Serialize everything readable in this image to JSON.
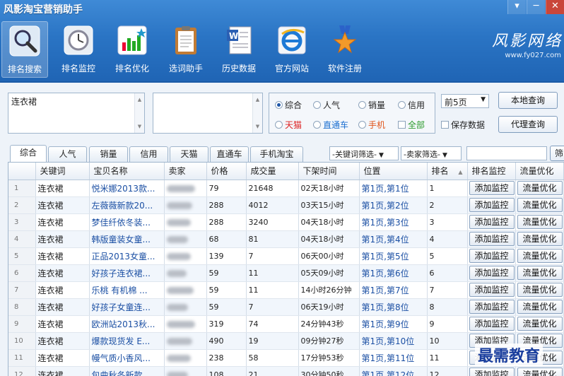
{
  "app": {
    "title": "风影淘宝营销助手",
    "window_buttons": [
      "▾",
      "─",
      "✕"
    ]
  },
  "toolbar": [
    {
      "label": "排名搜索",
      "icon": "magnifier-icon",
      "active": true
    },
    {
      "label": "排名监控",
      "icon": "clock-icon",
      "active": false
    },
    {
      "label": "排名优化",
      "icon": "bar-chart-icon",
      "active": false
    },
    {
      "label": "选词助手",
      "icon": "clipboard-icon",
      "active": false
    },
    {
      "label": "历史数据",
      "icon": "document-icon",
      "active": false
    },
    {
      "label": "官方网站",
      "icon": "browser-e-icon",
      "active": false
    },
    {
      "label": "软件注册",
      "icon": "star-medal-icon",
      "active": false
    }
  ],
  "brand": {
    "name": "风影网络",
    "url": "www.fy027.com"
  },
  "search": {
    "keyword_value": "连衣裙",
    "filters": {
      "sort_options": [
        "综合",
        "人气",
        "销量",
        "信用"
      ],
      "selected_sort": "综合",
      "platform_options": [
        "天猫",
        "直通车",
        "手机"
      ],
      "all_label": "全部"
    },
    "pages_value": "前5页",
    "save_data_label": "保存数据",
    "local_query_label": "本地查询",
    "proxy_query_label": "代理查询"
  },
  "tabs": [
    "综合",
    "人气",
    "销量",
    "信用",
    "天猫",
    "直通车",
    "手机淘宝"
  ],
  "keyword_filter": "-关键词筛选-",
  "seller_filter": "-卖家筛选-",
  "filter_button_label": "筛",
  "table": {
    "columns": [
      "关键词",
      "宝贝名称",
      "卖家",
      "价格",
      "成交量",
      "下架时间",
      "位置",
      "排名",
      "排名监控",
      "流量优化"
    ],
    "sort_indicator": "▲",
    "rows": [
      {
        "n": "1",
        "kw": "连衣裙",
        "name": "悦米娜2013款...",
        "price": "79",
        "sales": "21648",
        "time": "02天18小时",
        "pos": "第1页,第1位",
        "rank": "1"
      },
      {
        "n": "2",
        "kw": "连衣裙",
        "name": "左薇薇新款20...",
        "price": "288",
        "sales": "4012",
        "time": "03天15小时",
        "pos": "第1页,第2位",
        "rank": "2"
      },
      {
        "n": "3",
        "kw": "连衣裙",
        "name": "梦佳纤依冬装...",
        "price": "288",
        "sales": "3240",
        "time": "04天18小时",
        "pos": "第1页,第3位",
        "rank": "3"
      },
      {
        "n": "4",
        "kw": "连衣裙",
        "name": "韩版童装女童...",
        "price": "68",
        "sales": "81",
        "time": "04天18小时",
        "pos": "第1页,第4位",
        "rank": "4"
      },
      {
        "n": "5",
        "kw": "连衣裙",
        "name": "正品2013女童...",
        "price": "139",
        "sales": "7",
        "time": "06天00小时",
        "pos": "第1页,第5位",
        "rank": "5"
      },
      {
        "n": "6",
        "kw": "连衣裙",
        "name": "好孩子连衣裙...",
        "price": "59",
        "sales": "11",
        "time": "05天09小时",
        "pos": "第1页,第6位",
        "rank": "6"
      },
      {
        "n": "7",
        "kw": "连衣裙",
        "name": "乐桃 有机棉 ...",
        "price": "59",
        "sales": "11",
        "time": "14小时26分钟",
        "pos": "第1页,第7位",
        "rank": "7"
      },
      {
        "n": "8",
        "kw": "连衣裙",
        "name": "好孩子女童连...",
        "price": "59",
        "sales": "7",
        "time": "06天19小时",
        "pos": "第1页,第8位",
        "rank": "8"
      },
      {
        "n": "9",
        "kw": "连衣裙",
        "name": "欧洲站2013秋...",
        "price": "319",
        "sales": "74",
        "time": "24分钟43秒",
        "pos": "第1页,第9位",
        "rank": "9"
      },
      {
        "n": "10",
        "kw": "连衣裙",
        "name": "爆款现货发 E...",
        "price": "490",
        "sales": "19",
        "time": "09分钟27秒",
        "pos": "第1页,第10位",
        "rank": "10"
      },
      {
        "n": "11",
        "kw": "连衣裙",
        "name": "幔气质小香风...",
        "price": "238",
        "sales": "58",
        "time": "17分钟53秒",
        "pos": "第1页,第11位",
        "rank": "11"
      },
      {
        "n": "12",
        "kw": "连衣裙",
        "name": "包曲秋冬新款...",
        "price": "108",
        "sales": "21",
        "time": "30分钟50秒",
        "pos": "第1页,第12位",
        "rank": "12"
      }
    ],
    "add_monitor_label": "添加监控",
    "optimize_label": "流量优化"
  },
  "watermark": "最需教育"
}
